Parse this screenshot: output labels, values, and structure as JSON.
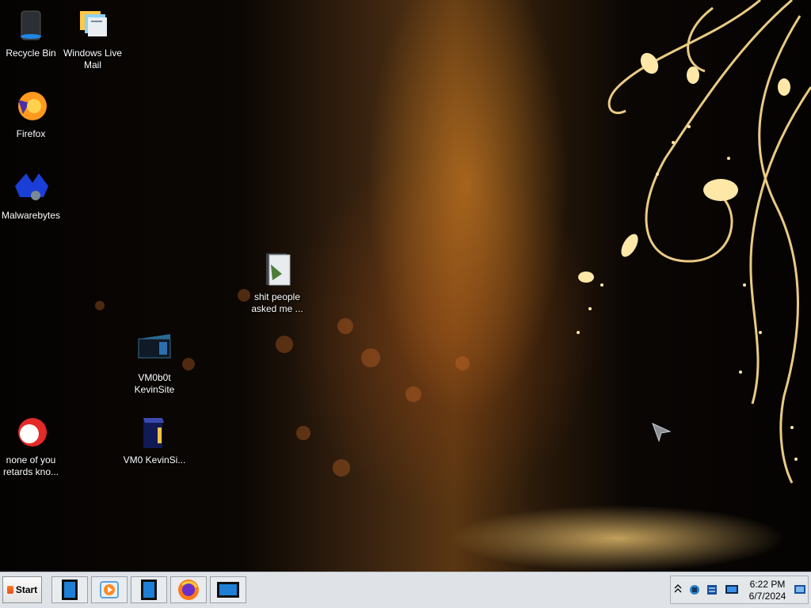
{
  "desktop": {
    "icons": [
      {
        "label": "Recycle Bin",
        "icon": "recycle-bin-icon"
      },
      {
        "label": "Windows Live Mail",
        "icon": "windows-live-mail-icon"
      },
      {
        "label": "Firefox",
        "icon": "firefox-icon"
      },
      {
        "label": "Malwarebytes",
        "icon": "malwarebytes-icon"
      },
      {
        "label": "shit people asked me ...",
        "icon": "folder-icon"
      },
      {
        "label": "VM0b0t KevinSite",
        "icon": "app-shortcut-icon"
      },
      {
        "label": "none of you retards kno...",
        "icon": "app-shortcut-icon"
      },
      {
        "label": "VM0 KevinSi...",
        "icon": "app-shortcut-icon"
      }
    ]
  },
  "taskbar": {
    "start_label": "Start",
    "buttons": [
      {
        "icon": "blue-window-icon"
      },
      {
        "icon": "media-player-icon"
      },
      {
        "icon": "blue-window-icon"
      },
      {
        "icon": "firefox-icon"
      },
      {
        "icon": "monitor-icon"
      }
    ],
    "tray": {
      "icons": [
        "chevron-up-icon",
        "network-icon",
        "server-icon",
        "display-icon",
        "notification-icon"
      ],
      "time": "6:22 PM",
      "date": "6/7/2024"
    }
  },
  "colors": {
    "taskbar_bg": "#dfe3e8",
    "wallpaper_gold": "#f2c46a",
    "wallpaper_dark": "#050302"
  }
}
